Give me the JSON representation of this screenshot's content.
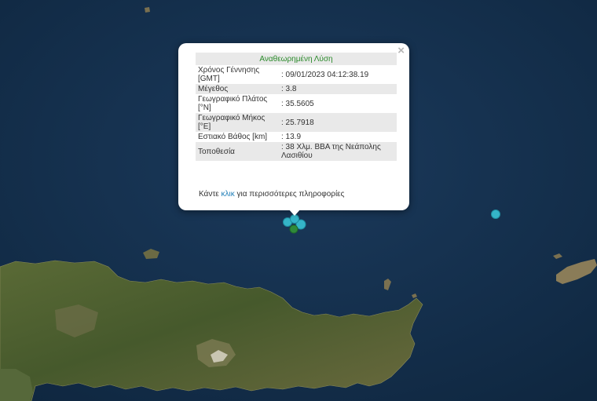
{
  "map": {
    "colors": {
      "sea": "#15314f",
      "land": "#4d6030",
      "marker": "#35b5c8",
      "marker_selected": "#2f8a3a"
    }
  },
  "popup": {
    "title": "Αναθεωρημένη Λύση",
    "close_symbol": "×",
    "rows": [
      {
        "label": "Χρόνος Γέννησης [GMT]",
        "value": ": 09/01/2023 04:12:38.19"
      },
      {
        "label": "Μέγεθος",
        "value": ": 3.8"
      },
      {
        "label": "Γεωγραφικό Πλάτος [°N]",
        "value": ": 35.5605"
      },
      {
        "label": "Γεωγραφικό Μήκος [°E]",
        "value": ": 25.7918"
      },
      {
        "label": "Εστιακό Βάθος [km]",
        "value": ": 13.9"
      },
      {
        "label": "Τοποθεσία",
        "value": ": 38 Χλμ. ΒΒΑ της Νεάπολης Λασιθίου"
      }
    ],
    "more_prefix": "Κάντε ",
    "more_link": "κλικ",
    "more_suffix": " για περισσότερες πληροφορίες"
  }
}
